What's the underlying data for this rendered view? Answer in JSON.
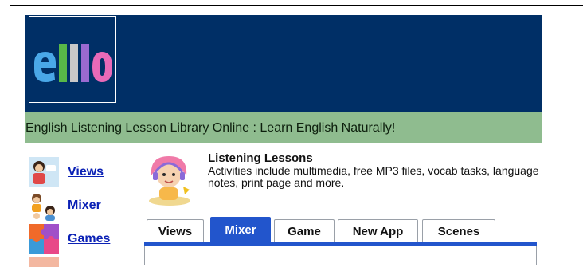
{
  "header": {
    "logo_text": "elllo",
    "tagline": "English Listening Lesson Library Online : Learn English Naturally!"
  },
  "sidebar": {
    "items": [
      {
        "label": "Views",
        "icon": "people-talking-icon"
      },
      {
        "label": "Mixer",
        "icon": "group-chat-icon"
      },
      {
        "label": "Games",
        "icon": "puzzle-icon"
      }
    ]
  },
  "main": {
    "section_title": "Listening Lessons",
    "section_description": "Activities include multimedia, free MP3 files, vocab tasks, language notes, print page and more.",
    "tabs": [
      {
        "label": "Views",
        "active": false
      },
      {
        "label": "Mixer",
        "active": true
      },
      {
        "label": "Game",
        "active": false
      },
      {
        "label": "New App",
        "active": false
      },
      {
        "label": "Scenes",
        "active": false
      }
    ]
  },
  "colors": {
    "banner": "#002f66",
    "tagline_bg": "#8fbc8f",
    "link": "#0b21b5",
    "active_tab": "#2255cc"
  }
}
